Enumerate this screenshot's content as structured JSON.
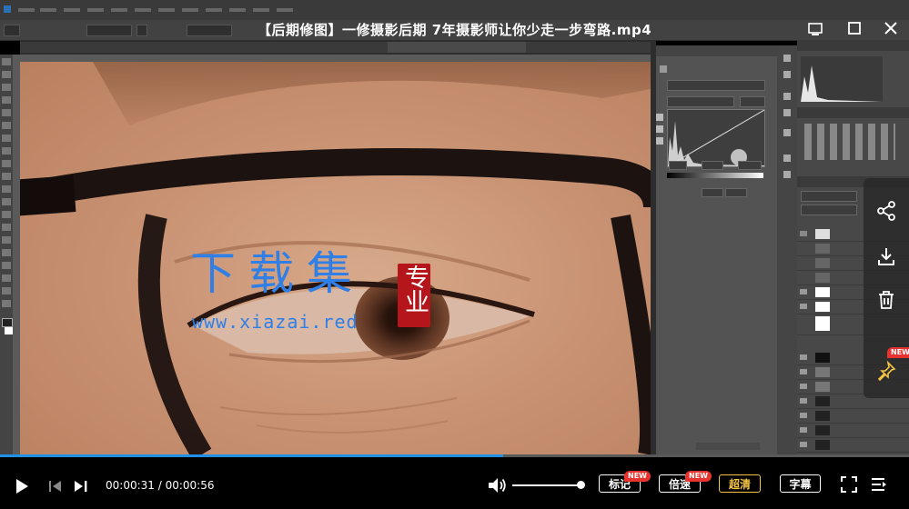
{
  "video": {
    "title": "【后期修图】一修摄影后期 7年摄影师让你少走一步弯路.mp4",
    "current_time": "00:00:31",
    "separator": " / ",
    "duration": "00:00:56",
    "progress": 0.554,
    "volume": 0.94
  },
  "controls": {
    "bookmark_label": "标记",
    "speed_label": "倍速",
    "quality_label": "超清",
    "subtitle_label": "字幕",
    "new_badge": "NEW"
  },
  "side_actions": {
    "new_badge": "NEW"
  },
  "watermark": {
    "cn_text": "下载集",
    "seal_text": "专业",
    "url": "www.xiazai.red"
  },
  "colors": {
    "accent": "#1e90e6",
    "badge": "#e8322d",
    "watermark": "#2f7fe6",
    "seal": "#b4161b",
    "quality_text": "#f5c542"
  }
}
